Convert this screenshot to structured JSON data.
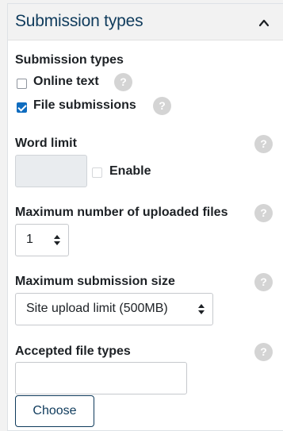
{
  "section": {
    "title": "Submission types",
    "collapse_icon": "chevron-up-icon"
  },
  "submission_types": {
    "label": "Submission types",
    "options": [
      {
        "label": "Online text",
        "checked": false
      },
      {
        "label": "File submissions",
        "checked": true
      }
    ]
  },
  "word_limit": {
    "label": "Word limit",
    "value": "",
    "enable_label": "Enable",
    "enabled": false
  },
  "max_files": {
    "label": "Maximum number of uploaded files",
    "selected": "1"
  },
  "max_size": {
    "label": "Maximum submission size",
    "selected": "Site upload limit (500MB)"
  },
  "file_types": {
    "label": "Accepted file types",
    "value": "",
    "choose_label": "Choose"
  },
  "help_glyph": "?",
  "colors": {
    "header_text": "#0f3b5c",
    "checkbox_checked": "#0f6cbf",
    "help_icon": "#d4d4d4"
  }
}
